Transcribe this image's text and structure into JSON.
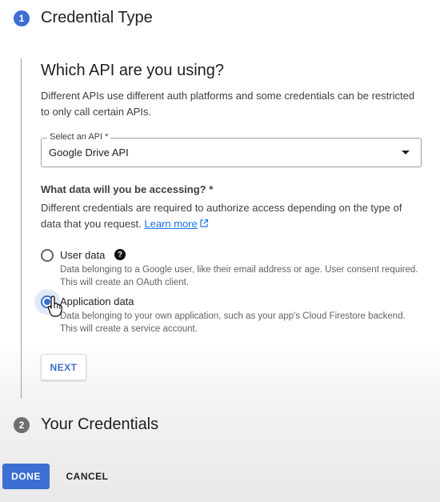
{
  "step1": {
    "number": "1",
    "title": "Credential Type"
  },
  "step2": {
    "number": "2",
    "title": "Your Credentials"
  },
  "section": {
    "heading": "Which API are you using?",
    "description": "Different APIs use different auth platforms and some credentials can be restricted to only call certain APIs."
  },
  "api_select": {
    "label": "Select an API *",
    "value": "Google Drive API"
  },
  "data_question": {
    "label": "What data will you be accessing? *",
    "description": "Different credentials are required to authorize access depending on the type of data that you request.",
    "learn_more": "Learn more"
  },
  "options": {
    "user_data": {
      "label": "User data",
      "description": "Data belonging to a Google user, like their email address or age. User consent required. This will create an OAuth client.",
      "selected": false
    },
    "application_data": {
      "label": "Application data",
      "description": "Data belonging to your own application, such as your app's Cloud Firestore backend. This will create a service account.",
      "selected": true
    }
  },
  "buttons": {
    "next": "NEXT",
    "done": "DONE",
    "cancel": "CANCEL"
  },
  "colors": {
    "accent": "#3c6fd1",
    "link": "#1a73e8",
    "inactive_step": "#6f6f6f"
  },
  "icons": {
    "help": "help-icon",
    "external_link": "external-link-icon",
    "dropdown": "dropdown-arrow-icon",
    "cursor": "hand-cursor-icon"
  }
}
